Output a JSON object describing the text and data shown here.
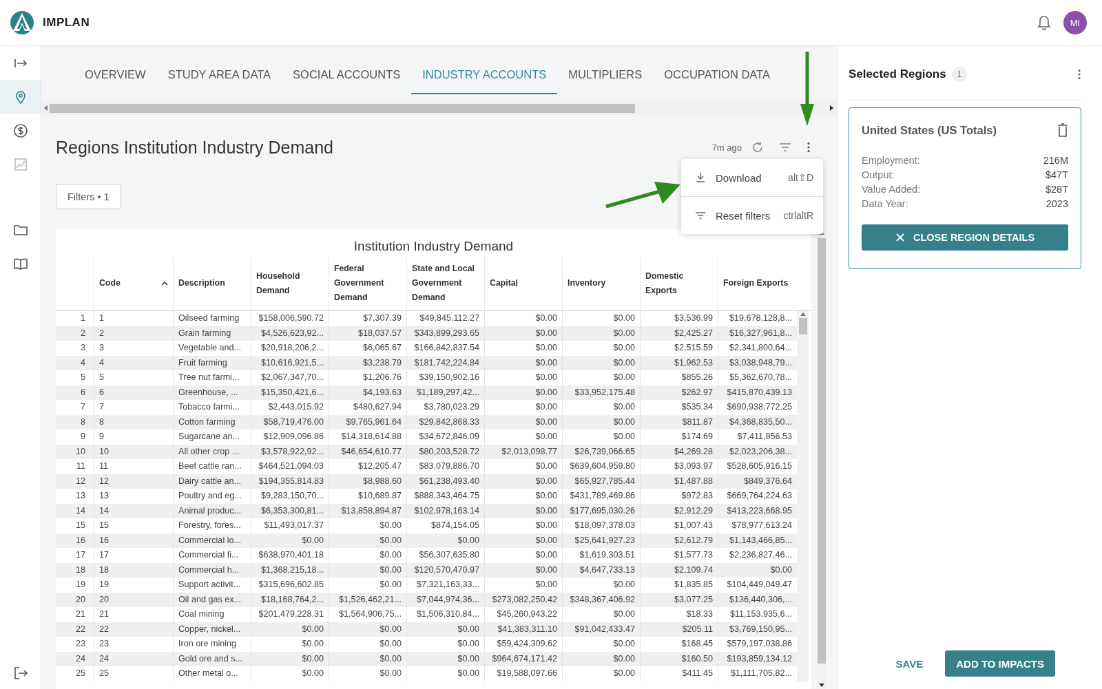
{
  "app": {
    "name": "IMPLAN",
    "avatar": "MI"
  },
  "sidebar": {
    "items": [
      {
        "kind": "expand",
        "selected": false,
        "disabled": false
      },
      {
        "kind": "location",
        "selected": true,
        "disabled": false
      },
      {
        "kind": "dollar",
        "selected": false,
        "disabled": false
      },
      {
        "kind": "chart",
        "selected": false,
        "disabled": true
      },
      {
        "kind": "folder",
        "selected": false,
        "disabled": false
      },
      {
        "kind": "book",
        "selected": false,
        "disabled": false
      }
    ]
  },
  "tabs": [
    {
      "label": "OVERVIEW",
      "selected": false
    },
    {
      "label": "STUDY AREA DATA",
      "selected": false
    },
    {
      "label": "SOCIAL ACCOUNTS",
      "selected": false
    },
    {
      "label": "INDUSTRY ACCOUNTS",
      "selected": true
    },
    {
      "label": "MULTIPLIERS",
      "selected": false
    },
    {
      "label": "OCCUPATION DATA",
      "selected": false
    }
  ],
  "report": {
    "title": "Regions Institution Industry Demand",
    "updated": "7m ago",
    "filters_button": "Filters • 1"
  },
  "menu": [
    {
      "kind": "download",
      "label": "Download",
      "shortcut": "alt⇧D"
    },
    {
      "kind": "reset",
      "label": "Reset filters",
      "shortcut": "ctrlaltR"
    }
  ],
  "table": {
    "title": "Institution Industry Demand",
    "columns": [
      {
        "label": "Code",
        "sort_ascending": true
      },
      {
        "label": "Description"
      },
      {
        "label": "Household Demand"
      },
      {
        "label": "Federal Government Demand"
      },
      {
        "label": "State and Local Government Demand"
      },
      {
        "label": "Capital"
      },
      {
        "label": "Inventory"
      },
      {
        "label": "Domestic Exports"
      },
      {
        "label": "Foreign Exports"
      }
    ],
    "rows": [
      {
        "row_number": "1",
        "cells": [
          "1",
          "Oilseed farming",
          "$158,006,590.72",
          "$7,307.39",
          "$49,845,112.27",
          "$0.00",
          "$0.00",
          "$3,536.99",
          "$19,678,128,8..."
        ]
      },
      {
        "row_number": "2",
        "cells": [
          "2",
          "Grain farming",
          "$4,526,623,92...",
          "$18,037.57",
          "$343,899,293.65",
          "$0.00",
          "$0.00",
          "$2,425.27",
          "$16,327,961,8..."
        ]
      },
      {
        "row_number": "3",
        "cells": [
          "3",
          "Vegetable and...",
          "$20,918,206,2...",
          "$6,065.67",
          "$166,842,837.54",
          "$0.00",
          "$0.00",
          "$2,515.59",
          "$2,341,800,64..."
        ]
      },
      {
        "row_number": "4",
        "cells": [
          "4",
          "Fruit farming",
          "$10,616,921,5...",
          "$3,238.79",
          "$181,742,224.84",
          "$0.00",
          "$0.00",
          "$1,962.53",
          "$3,038,948,79..."
        ]
      },
      {
        "row_number": "5",
        "cells": [
          "5",
          "Tree nut farmi...",
          "$2,067,347,70...",
          "$1,206.76",
          "$39,150,902.16",
          "$0.00",
          "$0.00",
          "$855.26",
          "$5,362,670,78..."
        ]
      },
      {
        "row_number": "6",
        "cells": [
          "6",
          "Greenhouse, ...",
          "$15,350,421,6...",
          "$4,193.63",
          "$1,189,297,42...",
          "$0.00",
          "$33,952,175.48",
          "$262.97",
          "$415,870,439.13"
        ]
      },
      {
        "row_number": "7",
        "cells": [
          "7",
          "Tobacco farmi...",
          "$2,443,015.92",
          "$480,627.94",
          "$3,780,023.29",
          "$0.00",
          "$0.00",
          "$535.34",
          "$690,938,772.25"
        ]
      },
      {
        "row_number": "8",
        "cells": [
          "8",
          "Cotton farming",
          "$58,719,476.00",
          "$9,765,961.64",
          "$29,842,868.33",
          "$0.00",
          "$0.00",
          "$811.87",
          "$4,368,835,50..."
        ]
      },
      {
        "row_number": "9",
        "cells": [
          "9",
          "Sugarcane an...",
          "$12,909,096.86",
          "$14,318,614.88",
          "$34,672,846.09",
          "$0.00",
          "$0.00",
          "$174.69",
          "$7,411,856.53"
        ]
      },
      {
        "row_number": "10",
        "cells": [
          "10",
          "All other crop ...",
          "$3,578,922,92...",
          "$46,654,610.77",
          "$80,203,528.72",
          "$2,013,098.77",
          "$26,739,066.65",
          "$4,269.28",
          "$2,023,206,38..."
        ]
      },
      {
        "row_number": "11",
        "cells": [
          "11",
          "Beef cattle ran...",
          "$464,521,094.03",
          "$12,205.47",
          "$83,079,886.70",
          "$0.00",
          "$639,604,959.80",
          "$3,093.97",
          "$528,605,916.15"
        ]
      },
      {
        "row_number": "12",
        "cells": [
          "12",
          "Dairy cattle an...",
          "$194,355,814.83",
          "$8,988.60",
          "$61,238,493.40",
          "$0.00",
          "$65,927,785.44",
          "$1,487.88",
          "$849,376.64"
        ]
      },
      {
        "row_number": "13",
        "cells": [
          "13",
          "Poultry and eg...",
          "$9,283,150,70...",
          "$10,689.87",
          "$888,343,464.75",
          "$0.00",
          "$431,789,469.86",
          "$972.83",
          "$669,764,224.63"
        ]
      },
      {
        "row_number": "14",
        "cells": [
          "14",
          "Animal produc...",
          "$6,353,300,81...",
          "$13,858,894.87",
          "$102,978,163.14",
          "$0.00",
          "$177,695,030.26",
          "$2,912.29",
          "$413,223,668.95"
        ]
      },
      {
        "row_number": "15",
        "cells": [
          "15",
          "Forestry, fores...",
          "$11,493,017.37",
          "$0.00",
          "$874,154.05",
          "$0.00",
          "$18,097,378.03",
          "$1,007.43",
          "$78,977,613.24"
        ]
      },
      {
        "row_number": "16",
        "cells": [
          "16",
          "Commercial lo...",
          "$0.00",
          "$0.00",
          "$0.00",
          "$0.00",
          "$25,641,927.23",
          "$2,612.79",
          "$1,143,466,85..."
        ]
      },
      {
        "row_number": "17",
        "cells": [
          "17",
          "Commercial fi...",
          "$638,970,401.18",
          "$0.00",
          "$56,307,635.80",
          "$0.00",
          "$1,619,303.51",
          "$1,577.73",
          "$2,236,827,46..."
        ]
      },
      {
        "row_number": "18",
        "cells": [
          "18",
          "Commercial h...",
          "$1,368,215,18...",
          "$0.00",
          "$120,570,470.97",
          "$0.00",
          "$4,647,733.13",
          "$2,109.74",
          "$0.00"
        ]
      },
      {
        "row_number": "19",
        "cells": [
          "19",
          "Support activit...",
          "$315,696,602.85",
          "$0.00",
          "$7,321,163,33...",
          "$0.00",
          "$0.00",
          "$1,835.85",
          "$104,449,049.47"
        ]
      },
      {
        "row_number": "20",
        "cells": [
          "20",
          "Oil and gas ex...",
          "$18,168,764,2...",
          "$1,526,462,21...",
          "$7,044,974,36...",
          "$273,082,250.42",
          "$348,367,406.92",
          "$3,077.25",
          "$136,440,306,..."
        ]
      },
      {
        "row_number": "21",
        "cells": [
          "21",
          "Coal mining",
          "$201,479,228.31",
          "$1,564,906,75...",
          "$1,506,310,84...",
          "$45,260,943.22",
          "$0.00",
          "$18.33",
          "$11,153,935,6..."
        ]
      },
      {
        "row_number": "22",
        "cells": [
          "22",
          "Copper, nickel...",
          "$0.00",
          "$0.00",
          "$0.00",
          "$41,383,311.10",
          "$91,042,433.47",
          "$205.11",
          "$3,769,150,95..."
        ]
      },
      {
        "row_number": "23",
        "cells": [
          "23",
          "Iron ore mining",
          "$0.00",
          "$0.00",
          "$0.00",
          "$59,424,309.62",
          "$0.00",
          "$168.45",
          "$579,197,038.86"
        ]
      },
      {
        "row_number": "24",
        "cells": [
          "24",
          "Gold ore and s...",
          "$0.00",
          "$0.00",
          "$0.00",
          "$964,674,171.42",
          "$0.00",
          "$160.50",
          "$193,859,134.12"
        ]
      },
      {
        "row_number": "25",
        "cells": [
          "25",
          "Other metal o...",
          "$0.00",
          "$0.00",
          "$0.00",
          "$19,588,097.66",
          "$0.00",
          "$411.45",
          "$1,111,705,82..."
        ]
      }
    ]
  },
  "panel": {
    "title": "Selected Regions",
    "count": "1",
    "region": {
      "name": "United States (US Totals)",
      "stats": [
        {
          "label": "Employment:",
          "value": "216M"
        },
        {
          "label": "Output:",
          "value": "$47T"
        },
        {
          "label": "Value Added:",
          "value": "$28T"
        },
        {
          "label": "Data Year:",
          "value": "2023"
        }
      ],
      "close_button": "CLOSE REGION DETAILS"
    },
    "save_button": "SAVE",
    "add_button": "ADD TO IMPACTS"
  }
}
